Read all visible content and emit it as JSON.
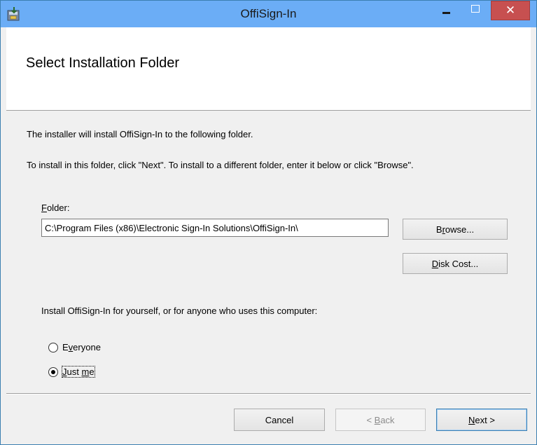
{
  "window": {
    "title": "OffiSign-In",
    "close_glyph": "✕"
  },
  "header": {
    "heading": "Select Installation Folder"
  },
  "body": {
    "line1": "The installer will install OffiSign-In to the following folder.",
    "line2": "To install in this folder, click \"Next\". To install to a different folder, enter it below or click \"Browse\".",
    "folder_label_ul": "F",
    "folder_label_rest": "older:",
    "folder_value": "C:\\Program Files (x86)\\Electronic Sign-In Solutions\\OffiSign-In\\",
    "browse_pre": "B",
    "browse_ul": "r",
    "browse_post": "owse...",
    "diskcost_ul": "D",
    "diskcost_post": "isk Cost...",
    "install_for": "Install OffiSign-In for yourself, or for anyone who uses this computer:",
    "everyone_pre": "E",
    "everyone_ul": "v",
    "everyone_post": "eryone",
    "justme_ul": "J",
    "justme_mid": "ust ",
    "justme_ul2": "m",
    "justme_post": "e",
    "selected_option": "Just me"
  },
  "footer": {
    "cancel_label": "Cancel",
    "back_pre": "< ",
    "back_ul": "B",
    "back_post": "ack",
    "next_ul": "N",
    "next_post": "ext >"
  },
  "icons": {
    "app": "installer-icon",
    "minimize": "minimize-icon",
    "maximize": "maximize-icon",
    "close": "close-icon"
  },
  "colors": {
    "titlebar": "#6badf6",
    "close_button": "#c75050",
    "window_border": "#3c7fb1"
  }
}
